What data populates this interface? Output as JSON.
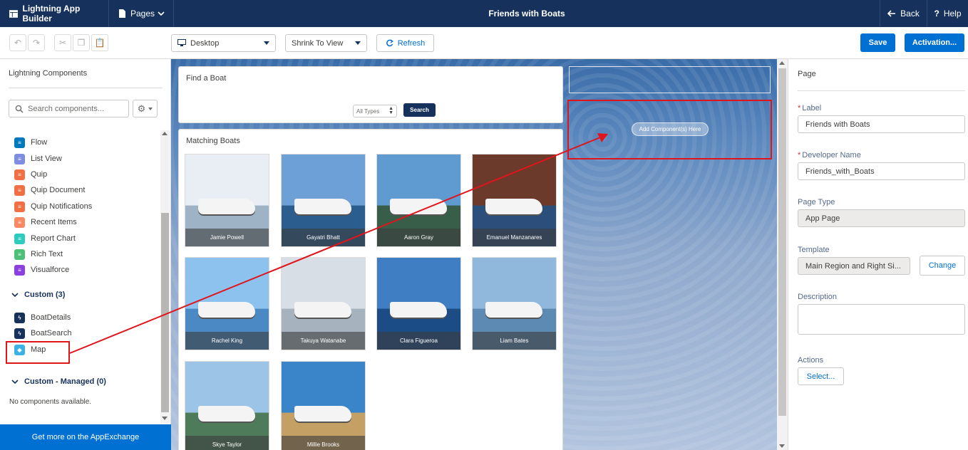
{
  "header": {
    "app_name": "Lightning App Builder",
    "pages_label": "Pages",
    "page_title": "Friends with Boats",
    "back_label": "Back",
    "help_label": "Help"
  },
  "toolbar": {
    "device_select": "Desktop",
    "zoom_select": "Shrink To View",
    "refresh_label": "Refresh",
    "save_label": "Save",
    "activation_label": "Activation..."
  },
  "left_panel": {
    "title": "Lightning Components",
    "search_placeholder": "Search components...",
    "standard_items": [
      {
        "label": "Flow",
        "icon": "flow-icon",
        "color": "#0079bc"
      },
      {
        "label": "List View",
        "icon": "list-view-icon",
        "color": "#7f8de1"
      },
      {
        "label": "Quip",
        "icon": "quip-icon",
        "color": "#f26e44"
      },
      {
        "label": "Quip Document",
        "icon": "quip-document-icon",
        "color": "#f26e44"
      },
      {
        "label": "Quip Notifications",
        "icon": "quip-notifications-icon",
        "color": "#f26e44"
      },
      {
        "label": "Recent Items",
        "icon": "recent-items-icon",
        "color": "#f88962"
      },
      {
        "label": "Report Chart",
        "icon": "report-chart-icon",
        "color": "#2ecbbe"
      },
      {
        "label": "Rich Text",
        "icon": "rich-text-icon",
        "color": "#4bc076"
      },
      {
        "label": "Visualforce",
        "icon": "visualforce-icon",
        "color": "#8c3fe1"
      }
    ],
    "custom_section": "Custom (3)",
    "custom_items": [
      {
        "label": "BoatDetails",
        "icon": "lightning-bolt-icon",
        "color": "#16325c"
      },
      {
        "label": "BoatSearch",
        "icon": "lightning-bolt-icon",
        "color": "#16325c"
      },
      {
        "label": "Map",
        "icon": "map-icon",
        "color": "#3bb2e6"
      }
    ],
    "managed_section": "Custom - Managed (0)",
    "no_components": "No components available.",
    "appexchange_label": "Get more on the AppExchange"
  },
  "canvas": {
    "find_card_title": "Find a Boat",
    "type_select": "All Types",
    "search_button": "Search",
    "matching_title": "Matching Boats",
    "boats": [
      {
        "owner": "Jamie Powell",
        "sky": "#e8eef4",
        "water": "#9fb3c6"
      },
      {
        "owner": "Gayatri Bhatt",
        "sky": "#6ea0d8",
        "water": "#2b5d8f"
      },
      {
        "owner": "Aaron Gray",
        "sky": "#5f9bd0",
        "water": "#385e4a"
      },
      {
        "owner": "Emanuel Manzanares",
        "sky": "#6b3a2a",
        "water": "#2b4f7a"
      },
      {
        "owner": "Rachel King",
        "sky": "#8dc2ee",
        "water": "#4a89c4"
      },
      {
        "owner": "Takuya Watanabe",
        "sky": "#d8dee6",
        "water": "#a6b3bf"
      },
      {
        "owner": "Clara Figueroa",
        "sky": "#3f7ec2",
        "water": "#1c4c86"
      },
      {
        "owner": "Liam Bates",
        "sky": "#8fb8dc",
        "water": "#5d8ab2"
      },
      {
        "owner": "Skye Taylor",
        "sky": "#9cc4e6",
        "water": "#4e7c5a"
      },
      {
        "owner": "Millie Brooks",
        "sky": "#3a84c9",
        "water": "#c4a065"
      }
    ],
    "add_component_label": "Add Component(s) Here"
  },
  "properties": {
    "heading": "Page",
    "label_field": "Label",
    "label_value": "Friends with Boats",
    "devname_field": "Developer Name",
    "devname_value": "Friends_with_Boats",
    "pagetype_field": "Page Type",
    "pagetype_value": "App Page",
    "template_field": "Template",
    "template_value": "Main Region and Right Si...",
    "change_label": "Change",
    "description_field": "Description",
    "actions_field": "Actions",
    "select_label": "Select..."
  }
}
